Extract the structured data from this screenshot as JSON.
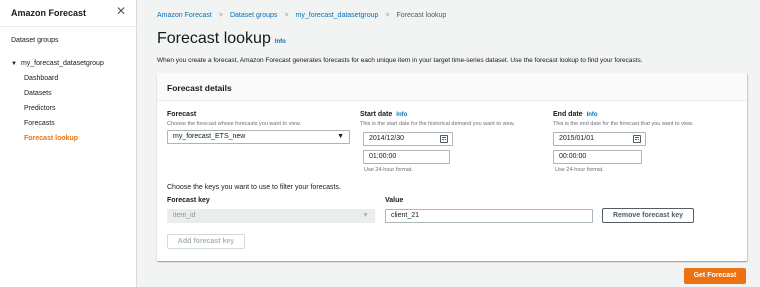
{
  "sidebar": {
    "title": "Amazon Forecast",
    "close_icon": "close-icon",
    "datasets_link": "Dataset groups",
    "group": {
      "name": "my_forecast_datasetgroup",
      "items": [
        {
          "label": "Dashboard",
          "active": false
        },
        {
          "label": "Datasets",
          "active": false
        },
        {
          "label": "Predictors",
          "active": false
        },
        {
          "label": "Forecasts",
          "active": false
        },
        {
          "label": "Forecast lookup",
          "active": true
        }
      ]
    }
  },
  "breadcrumb": {
    "items": [
      "Amazon Forecast",
      "Dataset groups",
      "my_forecast_datasetgroup"
    ],
    "current": "Forecast lookup",
    "separator": ">"
  },
  "page": {
    "title": "Forecast lookup",
    "info": "Info",
    "description": "When you create a forecast, Amazon Forecast generates forecasts for each unique item in your target time-series dataset. Use the forecast lookup to find your forecasts."
  },
  "panel": {
    "title": "Forecast details",
    "forecast": {
      "label": "Forecast",
      "description": "Choose the forecast whose forecasts you want to view.",
      "value": "my_forecast_ETS_new"
    },
    "start_date": {
      "label": "Start date",
      "info": "Info",
      "description": "This is the start date for the historical demand you want to view.",
      "date": "2014/12/30",
      "time": "01:00:00",
      "hint": "Use 24-hour format."
    },
    "end_date": {
      "label": "End date",
      "info": "Info",
      "description": "This is the end date for the forecast that you want to view.",
      "date": "2015/01/01",
      "time": "00:00:00",
      "hint": "Use 24-hour format."
    },
    "keys_intro": "Choose the keys you want to use to filter your forecasts.",
    "forecast_key": {
      "label": "Forecast key",
      "value": "item_id"
    },
    "value": {
      "label": "Value",
      "value": "client_21"
    },
    "remove_button": "Remove forecast key",
    "add_button": "Add forecast key"
  },
  "get_forecast_button": "Get Forecast",
  "colors": {
    "accent": "#ec7211",
    "link": "#0073bb"
  }
}
